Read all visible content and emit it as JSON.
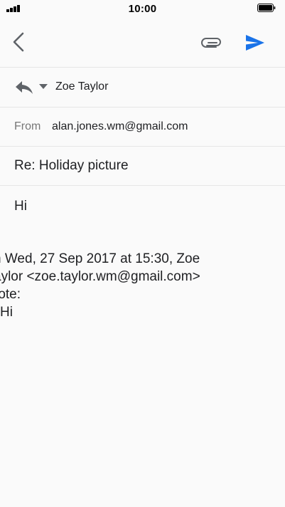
{
  "status_bar": {
    "time": "10:00"
  },
  "toolbar": {
    "back_icon": "chevron-left-icon",
    "attach_icon": "paperclip-icon",
    "send_icon": "send-icon",
    "accent_color": "#1a73e8"
  },
  "reply": {
    "icon": "reply-icon",
    "recipient": "Zoe Taylor"
  },
  "from": {
    "label": "From",
    "address": "alan.jones.wm@gmail.com"
  },
  "subject": "Re: Holiday picture",
  "body": {
    "text": "Hi",
    "quote_lines": [
      "n Wed, 27 Sep 2017 at 15:30, Zoe",
      "aylor <zoe.taylor.wm@gmail.com>",
      "rote:",
      "Hi"
    ]
  }
}
